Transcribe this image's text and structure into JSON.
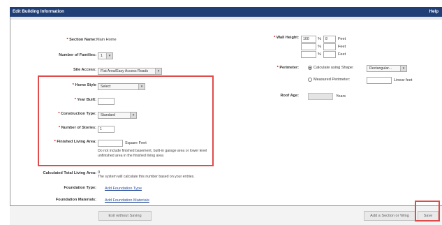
{
  "window": {
    "title": "Edit Building Information",
    "help": "Help"
  },
  "section_name": {
    "label": "Section Name:",
    "value": "Main Home"
  },
  "families": {
    "label": "Number of Families:",
    "value": "1"
  },
  "site_access": {
    "label": "Site Access:",
    "value": "Flat Area/Easy Access Roads"
  },
  "home_style": {
    "label": "Home Style",
    "value": "Select"
  },
  "year_built": {
    "label": "Year Built:",
    "value": ""
  },
  "construction_type": {
    "label": "Construction Type:",
    "value": "Standard"
  },
  "stories": {
    "label": "Number of Stories:",
    "value": "1"
  },
  "finished_area": {
    "label": "Finished Living Area:",
    "value": "",
    "unit": "Square Feet",
    "note": "Do not include finished basement, built-in garage area or lower level unfinished area in the finished living area"
  },
  "calc_total": {
    "label": "Calculated Total Living Area:",
    "value": "0",
    "note": "The system will calculate this number based on your entries."
  },
  "foundation_type": {
    "label": "Foundation Type:",
    "link": "Add Foundation Type"
  },
  "foundation_materials": {
    "label": "Foundation Materials:",
    "link": "Add Foundation Materials"
  },
  "wall_height": {
    "label": "Wall Height:",
    "rows": [
      {
        "pct": "100",
        "pct_sign": "%",
        "feet": "8",
        "unit": "Feet"
      },
      {
        "pct": "",
        "pct_sign": "%",
        "feet": "",
        "unit": "Feet"
      },
      {
        "pct": "",
        "pct_sign": "%",
        "feet": "",
        "unit": "Feet"
      }
    ]
  },
  "perimeter": {
    "label": "Perimeter:",
    "option_shape": "Calculate using Shape:",
    "shape_value": "Rectangular...",
    "option_measured": "Measured Perimeter:",
    "measured_value": "",
    "measured_unit": "Linear feet",
    "selected": "shape"
  },
  "roof_age": {
    "label": "Roof Age:",
    "value": "",
    "unit": "Years"
  },
  "footer": {
    "exit_label": "Exit without Saving",
    "add_section_label": "Add a Section or Wing",
    "save_label": "Save"
  },
  "colors": {
    "titlebar": "#203f77",
    "highlight": "#e04a4a",
    "link": "#2a4fa0",
    "required": "#cc0000"
  }
}
